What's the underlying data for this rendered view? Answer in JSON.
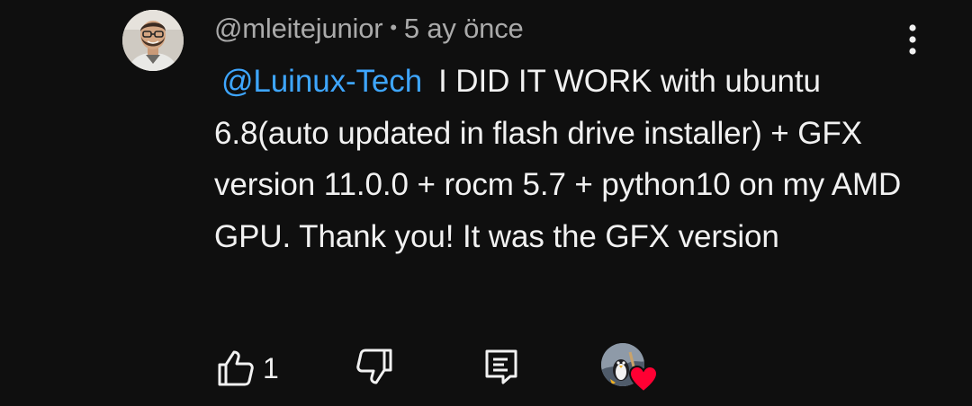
{
  "comment": {
    "author": "@mleitejunior",
    "separator": "•",
    "time_ago": "5 ay önce",
    "mention": "@Luinux-Tech",
    "text": "I DID IT WORK with ubuntu 6.8(auto updated in flash drive installer) + GFX version 11.0.0 + rocm 5.7 + python10 on my AMD GPU. Thank you! It was the GFX version",
    "like_count": "1"
  },
  "icons": {
    "avatar": "user-avatar",
    "more": "more-vert-icon",
    "like": "thumb-up-icon",
    "dislike": "thumb-down-icon",
    "reply": "reply-comment-icon",
    "creator_avatar": "creator-avatar",
    "heart": "heart-icon"
  },
  "colors": {
    "background": "#0f0f0f",
    "text": "#f1f1f1",
    "meta": "#aaaaaa",
    "mention": "#3ea6ff",
    "heart": "#ff0033"
  }
}
